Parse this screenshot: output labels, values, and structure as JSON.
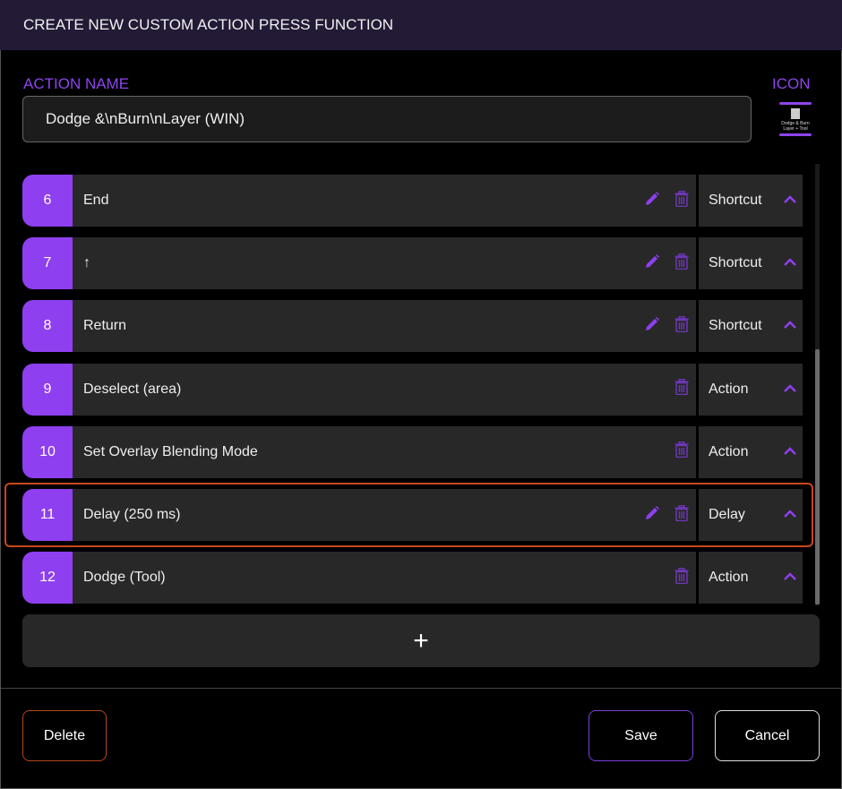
{
  "header": {
    "title": "CREATE NEW CUSTOM ACTION PRESS FUNCTION"
  },
  "action_name": {
    "label": "ACTION NAME",
    "value": "Dodge &\\nBurn\\nLayer (WIN)"
  },
  "icon": {
    "label": "ICON",
    "text": "Dodge & Burn Layer + Tool"
  },
  "colors": {
    "accent": "#8e3ff0",
    "highlight": "#c9461c",
    "header_bg": "#231a36"
  },
  "rows": [
    {
      "num": "6",
      "name": "End",
      "editable": true,
      "type": "Shortcut"
    },
    {
      "num": "7",
      "name": "↑",
      "editable": true,
      "type": "Shortcut"
    },
    {
      "num": "8",
      "name": "Return",
      "editable": true,
      "type": "Shortcut"
    },
    {
      "num": "9",
      "name": "Deselect (area)",
      "editable": false,
      "type": "Action"
    },
    {
      "num": "10",
      "name": "Set Overlay Blending Mode",
      "editable": false,
      "type": "Action"
    },
    {
      "num": "11",
      "name": "Delay (250 ms)",
      "editable": true,
      "type": "Delay",
      "selected": true
    },
    {
      "num": "12",
      "name": "Dodge (Tool)",
      "editable": false,
      "type": "Action"
    }
  ],
  "add_label": "+",
  "footer": {
    "delete": "Delete",
    "save": "Save",
    "cancel": "Cancel"
  }
}
